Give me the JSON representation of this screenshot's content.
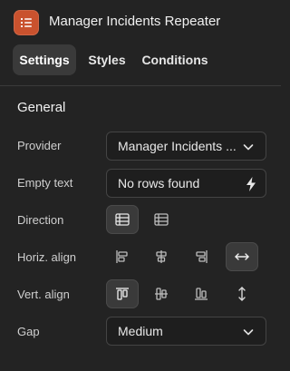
{
  "header": {
    "title": "Manager Incidents Repeater",
    "icon": "list-icon",
    "icon_color": "#c9522e"
  },
  "tabs": [
    {
      "label": "Settings",
      "active": true
    },
    {
      "label": "Styles",
      "active": false
    },
    {
      "label": "Conditions",
      "active": false
    }
  ],
  "section": {
    "title": "General"
  },
  "fields": {
    "provider": {
      "label": "Provider",
      "value": "Manager Incidents ..."
    },
    "empty_text": {
      "label": "Empty text",
      "value": "No rows found"
    },
    "direction": {
      "label": "Direction",
      "options": [
        "rows-icon",
        "columns-icon"
      ],
      "selected": 0
    },
    "horiz_align": {
      "label": "Horiz. align",
      "options": [
        "align-left-icon",
        "align-center-icon",
        "align-right-icon",
        "stretch-horizontal-icon"
      ],
      "selected": 3
    },
    "vert_align": {
      "label": "Vert. align",
      "options": [
        "align-top-icon",
        "align-middle-icon",
        "align-bottom-icon",
        "stretch-vertical-icon"
      ],
      "selected": 0
    },
    "gap": {
      "label": "Gap",
      "value": "Medium"
    }
  }
}
